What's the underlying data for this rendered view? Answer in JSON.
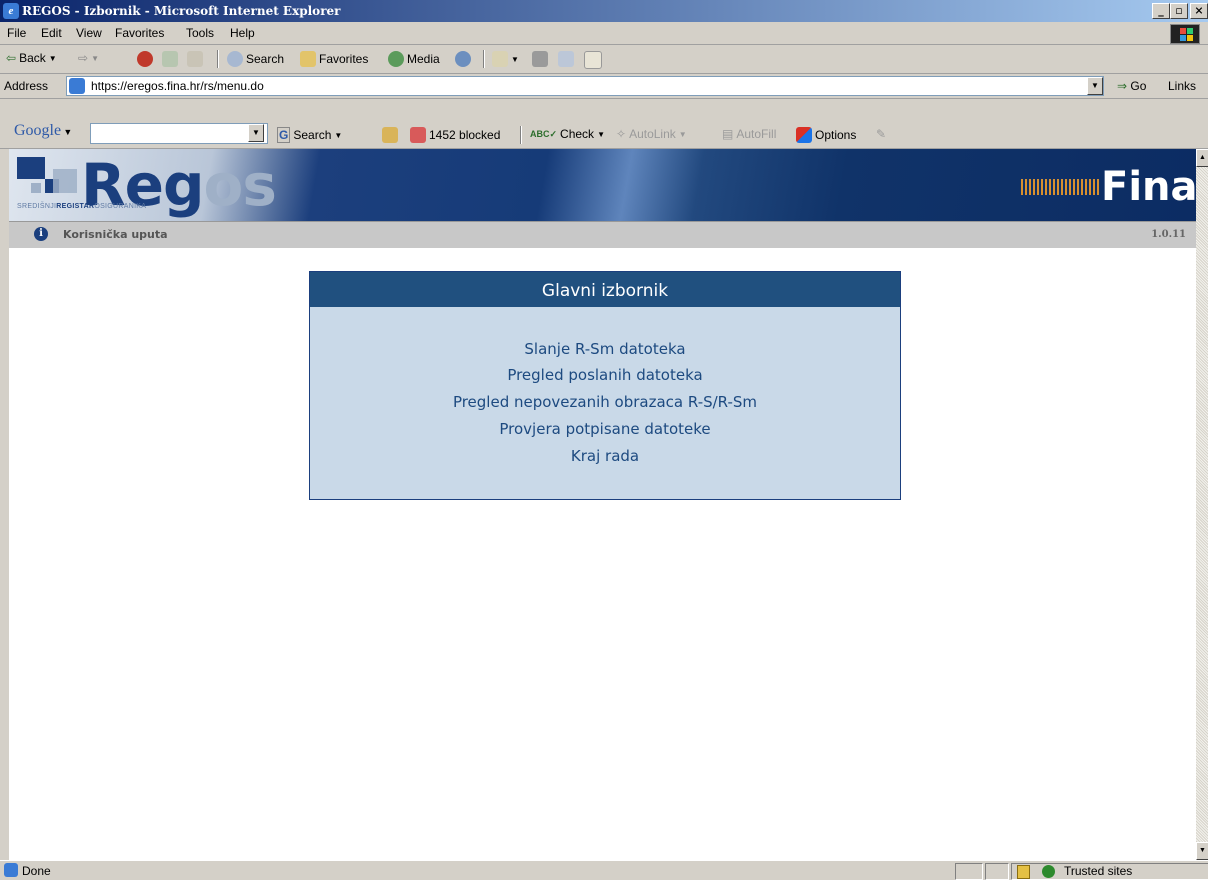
{
  "window": {
    "title": "REGOS - Izbornik - Microsoft Internet Explorer",
    "min": "_",
    "max": "▫",
    "close": "×"
  },
  "menubar": [
    "File",
    "Edit",
    "View",
    "Favorites",
    "Tools",
    "Help"
  ],
  "toolbar": {
    "back": "Back",
    "search": "Search",
    "favorites": "Favorites",
    "media": "Media"
  },
  "address": {
    "label": "Address",
    "url": "https://eregos.fina.hr/rs/menu.do",
    "go": "Go",
    "links": "Links"
  },
  "google": {
    "brand": "Google",
    "search": "Search",
    "blocked": "1452 blocked",
    "check": "Check",
    "autolink": "AutoLink",
    "autofill": "AutoFill",
    "options": "Options"
  },
  "banner": {
    "logo_main": "Reg",
    "logo_tail": "os",
    "logo_sub_a": "SREDIŠNJI",
    "logo_sub_b": "REGISTAR",
    "logo_sub_c": "OSIGURANIKA",
    "fina": "Fina"
  },
  "infobar": {
    "manual": "Korisnička uputa",
    "version": "1.0.11"
  },
  "menu": {
    "title": "Glavni izbornik",
    "items": [
      "Slanje R-Sm datoteka",
      "Pregled poslanih datoteka",
      "Pregled nepovezanih obrazaca R-S/R-Sm",
      "Provjera potpisane datoteke",
      "Kraj rada"
    ]
  },
  "status": {
    "text": "Done",
    "zone": "Trusted sites"
  },
  "colors": {
    "brand_blue": "#1b3f7e",
    "menu_header": "#20507f",
    "menu_bg": "#c9d9e8",
    "fina_orange": "#d8902f"
  }
}
